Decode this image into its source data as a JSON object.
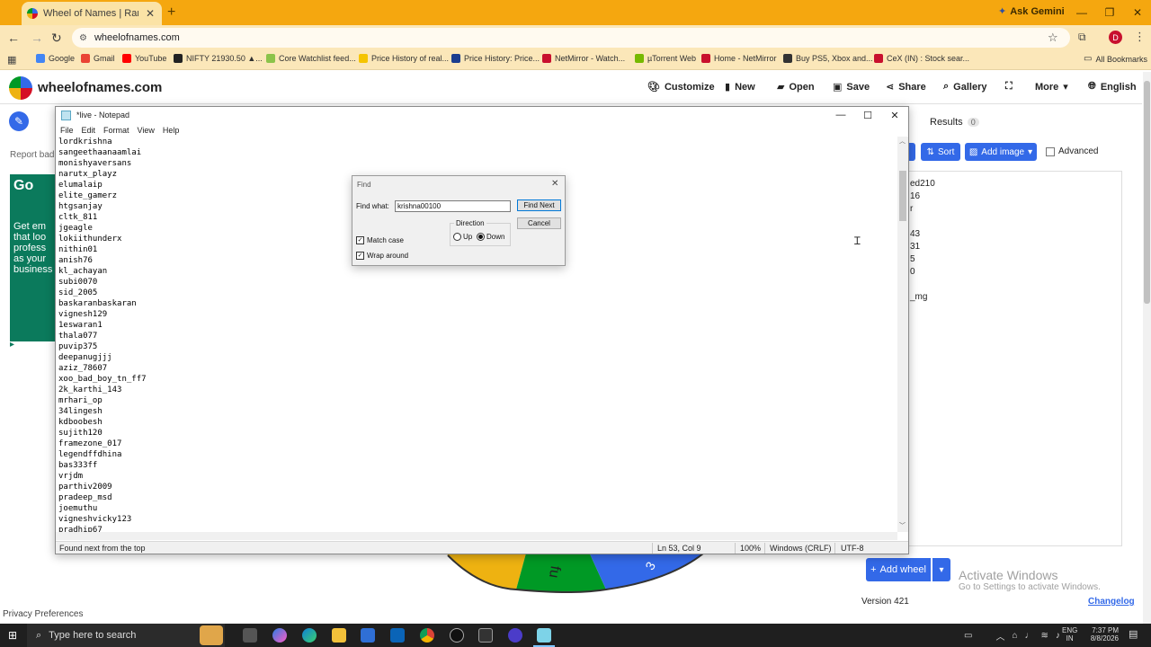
{
  "browser": {
    "tab_title": "Wheel of Names | Random nam",
    "new_tab": "+",
    "ask_gemini": "Ask Gemini",
    "url": "wheelofnames.com",
    "avatar_letter": "D"
  },
  "bookmarks": [
    {
      "label": "Google",
      "color": "#4285f4"
    },
    {
      "label": "Gmail",
      "color": "#ea4335"
    },
    {
      "label": "YouTube",
      "color": "#ff0000"
    },
    {
      "label": "NIFTY 21930.50 ▲...",
      "color": "#222222"
    },
    {
      "label": "Core Watchlist feed...",
      "color": "#8bc34a"
    },
    {
      "label": "Price History of real...",
      "color": "#f5c400"
    },
    {
      "label": "Price History: Price...",
      "color": "#1a3d8f"
    },
    {
      "label": "NetMirror - Watch...",
      "color": "#c8102e"
    },
    {
      "label": "µTorrent Web",
      "color": "#76b900"
    },
    {
      "label": "Home - NetMirror",
      "color": "#c8102e"
    },
    {
      "label": "Buy PS5, Xbox and...",
      "color": "#333333"
    },
    {
      "label": "CeX (IN) : Stock sear...",
      "color": "#c8102e"
    }
  ],
  "all_bookmarks": "All Bookmarks",
  "site": {
    "name": "wheelofnames.com",
    "nav": [
      "Customize",
      "New",
      "Open",
      "Save",
      "Share",
      "Gallery",
      "More",
      "English"
    ],
    "report_bad": "Report bad",
    "ad_logo": "Go",
    "ad_text": "Get em that loo profess as your business",
    "results_label": "Results",
    "results_count": "0",
    "sort_label": "Sort",
    "add_image_label": "Add image",
    "advanced_label": "Advanced",
    "entries_visible": [
      "ed210",
      "16",
      "r",
      "",
      "43",
      "31",
      "5",
      "0",
      "",
      "_mg"
    ],
    "add_wheel_label": "Add wheel",
    "activate_title": "Activate Windows",
    "activate_sub": "Go to Settings to activate Windows.",
    "version": "Version 421",
    "changelog": "Changelog",
    "privacy": "Privacy Preferences"
  },
  "notepad": {
    "title": "*live - Notepad",
    "menu": [
      "File",
      "Edit",
      "Format",
      "View",
      "Help"
    ],
    "lines": [
      "lordkrishna",
      "sangeethaanaamlai",
      "monishyaversans",
      "narutx_playz",
      "elumalaip",
      "elite_gamerz",
      "htgsanjay",
      "cltk_811",
      "jgeagle",
      "lokiithunderx",
      "nithin01",
      "anish76",
      "kl_achayan",
      "subi0070",
      "sid_2005",
      "baskaranbaskaran",
      "vignesh129",
      "1eswaran1",
      "thala077",
      "puvip375",
      "deepanugjjj",
      "aziz_78607",
      "xoo_bad_boy_tn_ff7",
      "2k_karthi_143",
      "mrhari_op",
      "34lingesh",
      "kdboobesh",
      "sujith120",
      "framezone_017",
      "legendffdhina",
      "bas333ff",
      "vrjdm",
      "parthiv2009",
      "pradeep_msd",
      "joemuthu",
      "vigneshvicky123",
      "pradhip67"
    ],
    "status": {
      "message": "Found next from the top",
      "position": "Ln 53, Col 9",
      "zoom": "100%",
      "line_ending": "Windows (CRLF)",
      "encoding": "UTF-8"
    }
  },
  "find_dialog": {
    "title": "Find",
    "find_what_label": "Find what:",
    "find_what_value": "krishna00100",
    "find_next": "Find Next",
    "cancel": "Cancel",
    "direction_label": "Direction",
    "up_label": "Up",
    "down_label": "Down",
    "match_case_label": "Match case",
    "wrap_around_label": "Wrap around",
    "match_case_checked": true,
    "wrap_around_checked": true,
    "direction_selected": "Down"
  },
  "taskbar": {
    "search_placeholder": "Type here to search",
    "lang_line1": "ENG",
    "lang_line2": "IN",
    "time": "7:37 PM",
    "date": "8/8/2026"
  }
}
